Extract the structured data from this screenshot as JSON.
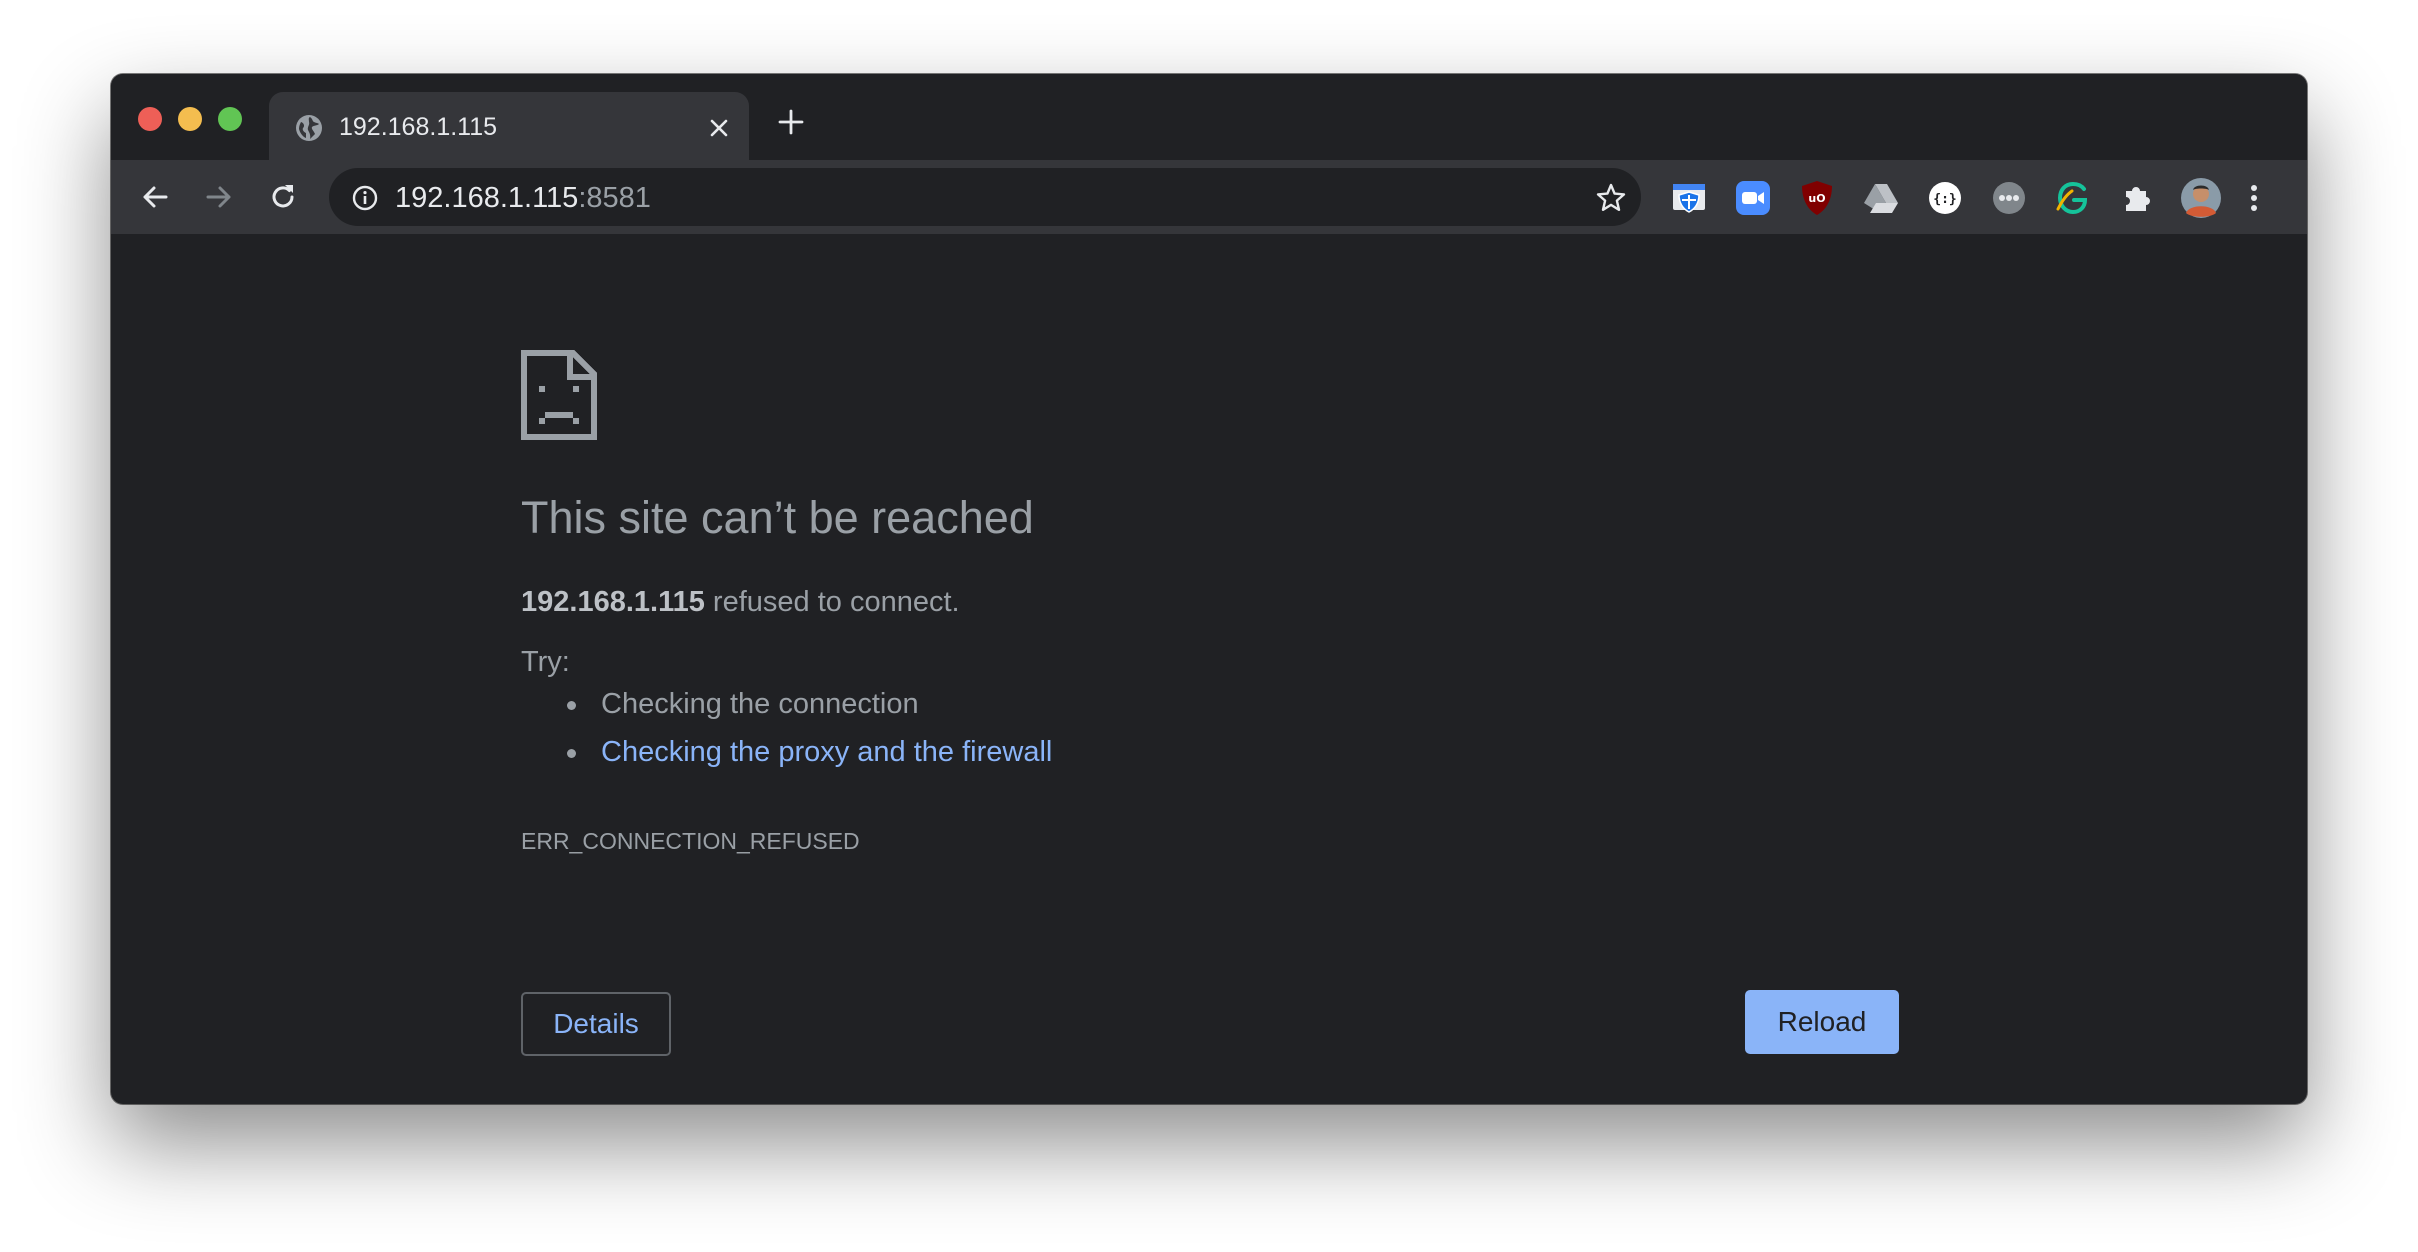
{
  "browser": {
    "tab": {
      "title": "192.168.1.115"
    },
    "address": {
      "host": "192.168.1.115",
      "port": ":8581"
    },
    "extensions": [
      "security-shield-icon",
      "zoom-video-icon",
      "ublock-origin-icon",
      "google-drive-icon",
      "json-formatter-icon",
      "duo-icon",
      "grammarly-icon",
      "extensions-puzzle-icon",
      "profile-avatar"
    ]
  },
  "error": {
    "heading": "This site can’t be reached",
    "host": "192.168.1.115",
    "message": " refused to connect.",
    "try_label": "Try:",
    "suggestions": [
      "Checking the connection",
      "Checking the proxy and the firewall"
    ],
    "code": "ERR_CONNECTION_REFUSED"
  },
  "buttons": {
    "details": "Details",
    "reload": "Reload"
  },
  "colors": {
    "page_bg": "#202124",
    "toolbar_bg": "#35363a",
    "text": "#9aa0a6",
    "link": "#8ab4f8",
    "primary_button": "#8ab4f8"
  }
}
